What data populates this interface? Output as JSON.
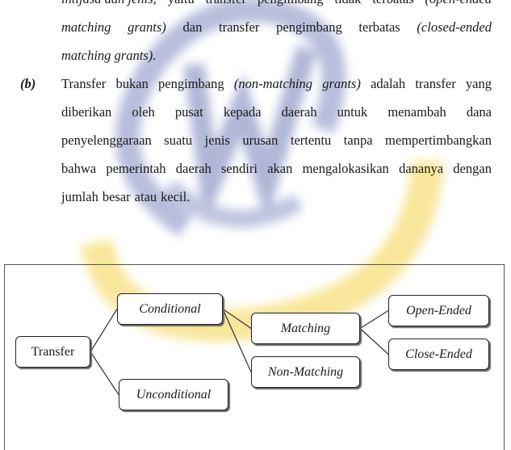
{
  "document": {
    "paragraph_a_tail": {
      "lines": [
        [
          {
            "text": "intijasa dan jenis,",
            "italic": true
          },
          {
            "text": "yaitu"
          },
          {
            "text": "transfer"
          },
          {
            "text": "pengimbang"
          },
          {
            "text": "tidak"
          },
          {
            "text": "terbatas"
          },
          {
            "text": "(open-ended",
            "italic": true
          }
        ],
        [
          {
            "text": "matching",
            "italic": true
          },
          {
            "text": "grants)",
            "italic": true
          },
          {
            "text": "dan"
          },
          {
            "text": "transfer"
          },
          {
            "text": "pengimbang"
          },
          {
            "text": "terbatas"
          },
          {
            "text": "(closed-ended",
            "italic": true
          }
        ],
        [
          {
            "text": "matching grants).",
            "italic": true
          }
        ]
      ]
    },
    "paragraph_b": {
      "label": "(b)",
      "lines": [
        [
          {
            "text": "Transfer"
          },
          {
            "text": "bukan"
          },
          {
            "text": "pengimbang"
          },
          {
            "text": "(non-matching",
            "italic": true
          },
          {
            "text": "grants)",
            "italic": true
          },
          {
            "text": "adalah"
          },
          {
            "text": "transfer"
          },
          {
            "text": "yang"
          }
        ],
        [
          {
            "text": "diberikan"
          },
          {
            "text": "oleh"
          },
          {
            "text": "pusat"
          },
          {
            "text": "kepada"
          },
          {
            "text": "daerah"
          },
          {
            "text": "untuk"
          },
          {
            "text": "menambah"
          },
          {
            "text": "dana"
          }
        ],
        [
          {
            "text": "penyelenggaraan"
          },
          {
            "text": "suatu"
          },
          {
            "text": "jenis"
          },
          {
            "text": "urusan"
          },
          {
            "text": "tertentu"
          },
          {
            "text": "tanpa"
          },
          {
            "text": "mempertimbangkan"
          }
        ],
        [
          {
            "text": "bahwa"
          },
          {
            "text": "pemerintah"
          },
          {
            "text": "daerah"
          },
          {
            "text": "sendiri"
          },
          {
            "text": "akan"
          },
          {
            "text": "mengalokasikan"
          },
          {
            "text": "dananya"
          },
          {
            "text": "dengan"
          }
        ],
        [
          {
            "text": "jumlah"
          },
          {
            "text": "besar"
          },
          {
            "text": "atau"
          },
          {
            "text": "kecil."
          }
        ]
      ]
    }
  },
  "diagram": {
    "nodes": {
      "transfer": {
        "label": "Transfer",
        "italic": false
      },
      "conditional": {
        "label": "Conditional",
        "italic": true
      },
      "unconditional": {
        "label": "Unconditional",
        "italic": true
      },
      "matching": {
        "label": "Matching",
        "italic": true
      },
      "non_matching": {
        "label": "Non-Matching",
        "italic": true
      },
      "open_ended": {
        "label": "Open-Ended",
        "italic": true
      },
      "close_ended": {
        "label": "Close-Ended",
        "italic": true
      }
    },
    "edges": [
      [
        "transfer",
        "conditional"
      ],
      [
        "transfer",
        "unconditional"
      ],
      [
        "conditional",
        "matching"
      ],
      [
        "conditional",
        "non_matching"
      ],
      [
        "matching",
        "open_ended"
      ],
      [
        "matching",
        "close_ended"
      ]
    ]
  },
  "watermark": {
    "colors": {
      "blue": "#8a95c8",
      "yellow": "#f3d34a"
    }
  }
}
